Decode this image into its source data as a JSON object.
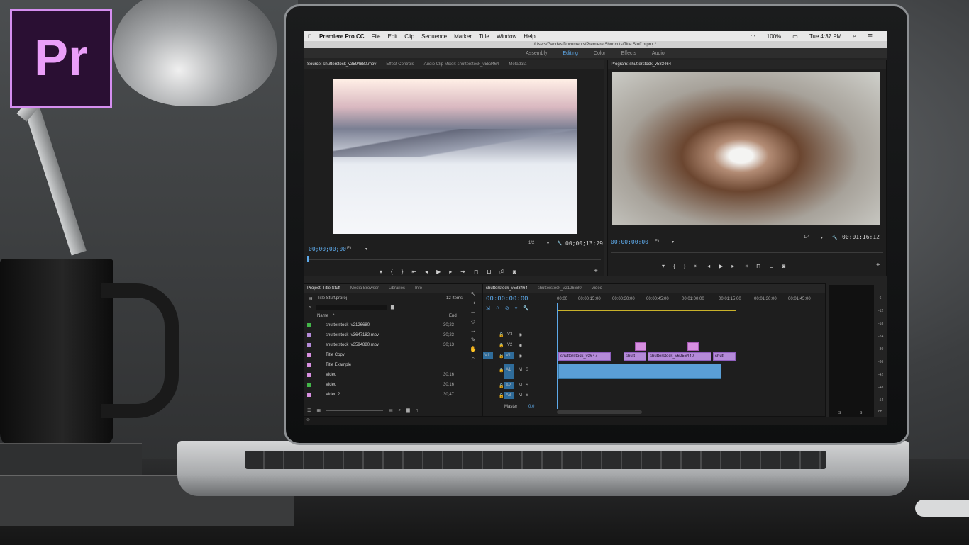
{
  "logo": {
    "text": "Pr",
    "color": "#ea9ef9",
    "background": "#2a0f33",
    "border": "#d58ef0"
  },
  "menubar": {
    "apple": "",
    "app_name": "Premiere Pro CC",
    "items": [
      "File",
      "Edit",
      "Clip",
      "Sequence",
      "Marker",
      "Title",
      "Window",
      "Help"
    ],
    "battery": "100%",
    "clock": "Tue 4:37 PM"
  },
  "window_path": "/Users/Geddes/Documents/Premiere Shortcuts/Title Stuff.prproj *",
  "workspace_tabs": [
    {
      "label": "Assembly"
    },
    {
      "label": "Editing"
    },
    {
      "label": "Color"
    },
    {
      "label": "Effects"
    },
    {
      "label": "Audio"
    }
  ],
  "source_panel": {
    "tabs": [
      "Source: shutterstock_v3594880.mov",
      "Effect Controls",
      "Audio Clip Mixer: shutterstock_v583464",
      "Metadata"
    ],
    "timecode": "00;00;00;00",
    "fit": "Fit",
    "zoom": "1/2",
    "duration": "00;00;13;29"
  },
  "program_panel": {
    "tabs": [
      "Program: shutterstock_v583464"
    ],
    "timecode": "00:00:00:00",
    "fit": "Fit",
    "zoom": "1/4",
    "duration": "00:01:16:12"
  },
  "project_panel": {
    "tabs": [
      "Project: Title Stuff",
      "Media Browser",
      "Libraries",
      "Info"
    ],
    "file": "Title Stuff.prproj",
    "count": "12 Items",
    "col_name": "Name",
    "col_end": "End",
    "items": [
      {
        "name": "shutterstock_v2126680",
        "dur": "30;23",
        "color": "#43b649"
      },
      {
        "name": "shutterstock_v3647182.mov",
        "dur": "30;23",
        "color": "#b48ad8"
      },
      {
        "name": "shutterstock_v3594880.mov",
        "dur": "30;13",
        "color": "#b48ad8"
      },
      {
        "name": "Title Copy",
        "dur": "",
        "color": "#d78fe0"
      },
      {
        "name": "Title Example",
        "dur": "",
        "color": "#d78fe0"
      },
      {
        "name": "Video",
        "dur": "30;16",
        "color": "#d78fe0"
      },
      {
        "name": "Video",
        "dur": "30;16",
        "color": "#43b649"
      },
      {
        "name": "Video 2",
        "dur": "30;47",
        "color": "#d78fe0"
      }
    ]
  },
  "timeline": {
    "tabs": [
      "shutterstock_v583464",
      "shutterstock_v2126680",
      "Video"
    ],
    "timecode": "00:00:00:00",
    "ruler": [
      "00:00",
      "00:00:15:00",
      "00:00:30:00",
      "00:00:45:00",
      "00:01:00:00",
      "00:01:15:00",
      "00:01:30:00",
      "00:01:45:00"
    ],
    "video_tracks": [
      "V3",
      "V2",
      "V1"
    ],
    "audio_tracks": [
      "A1",
      "A2",
      "A3"
    ],
    "master": "Master",
    "master_val": "0.0",
    "source_v": "V1",
    "source_a": "A1",
    "clips": [
      {
        "label": "shutterstock_v3647"
      },
      {
        "label": "shutt"
      },
      {
        "label": "shutterstock_v6256440"
      },
      {
        "label": "shutt"
      }
    ]
  },
  "audio_meter": {
    "labels": [
      "-6",
      "-12",
      "-18",
      "-24",
      "-30",
      "-36",
      "-42",
      "-48",
      "-54",
      "dB"
    ],
    "bottom": [
      "S",
      "S"
    ]
  }
}
